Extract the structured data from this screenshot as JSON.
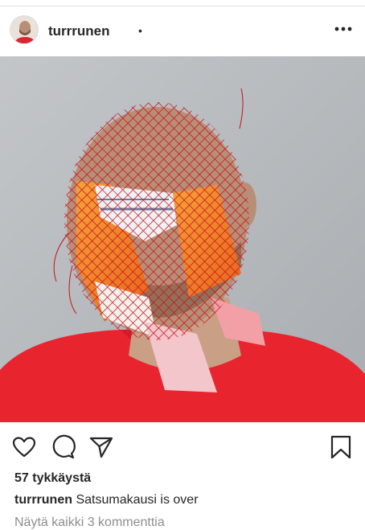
{
  "post": {
    "username": "turrrunen",
    "separator": "•",
    "more_icon": "more-horizontal-icon"
  },
  "actions": {
    "like_icon": "heart-icon",
    "comment_icon": "comment-icon",
    "share_icon": "send-icon",
    "save_icon": "bookmark-icon"
  },
  "likes": "57 tykkäystä",
  "caption": {
    "username": "turrrunen",
    "text": "Satsumakausi is over"
  },
  "comments_link": "Näytä kaikki 3 kommenttia",
  "colors": {
    "shirt": "#e8242f",
    "net": "#d8141e",
    "background": "#b8bcc0",
    "text": "#262626",
    "muted": "#8e8e8e"
  }
}
